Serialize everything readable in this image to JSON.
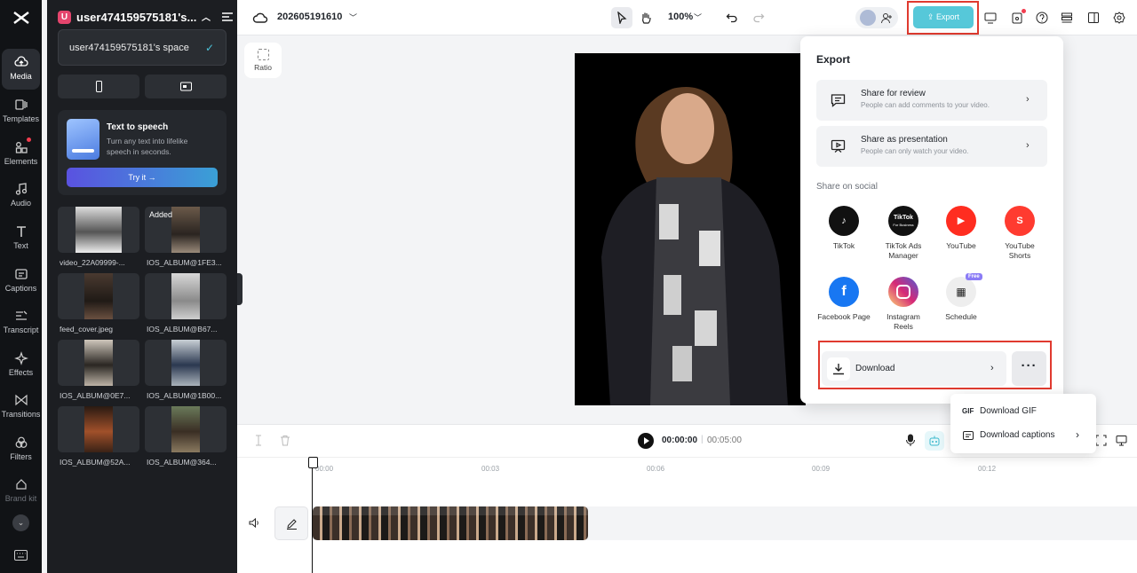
{
  "workspace": {
    "badge": "U",
    "name": "user474159575181's...",
    "dropdown_item": "user474159575181's space"
  },
  "rail": {
    "items": [
      "Media",
      "Templates",
      "Elements",
      "Audio",
      "Text",
      "Captions",
      "Transcript",
      "Effects",
      "Transitions",
      "Filters",
      "Brand kit"
    ]
  },
  "tts": {
    "title": "Text to speech",
    "desc": "Turn any text into lifelike speech in seconds.",
    "button": "Try it →"
  },
  "media": [
    {
      "name": "video_22A09999-...",
      "added": ""
    },
    {
      "name": "IOS_ALBUM@1FE3...",
      "added": "Added"
    },
    {
      "name": "feed_cover.jpeg",
      "added": ""
    },
    {
      "name": "IOS_ALBUM@B67...",
      "added": ""
    },
    {
      "name": "IOS_ALBUM@0E7...",
      "added": ""
    },
    {
      "name": "IOS_ALBUM@1B00...",
      "added": ""
    },
    {
      "name": "IOS_ALBUM@52A...",
      "added": ""
    },
    {
      "name": "IOS_ALBUM@364...",
      "added": ""
    }
  ],
  "topbar": {
    "project_name": "202605191610",
    "zoom": "100%",
    "export_label": "Export"
  },
  "canvas": {
    "ratio_label": "Ratio"
  },
  "timeline": {
    "current": "00:00:00",
    "separator": "|",
    "duration": "00:05:00",
    "ticks": [
      "00:00",
      "00:03",
      "00:06",
      "00:09",
      "00:12"
    ]
  },
  "export_panel": {
    "title": "Export",
    "review_title": "Share for review",
    "review_desc": "People can add comments to your video.",
    "presentation_title": "Share as presentation",
    "presentation_desc": "People can only watch your video.",
    "social_heading": "Share on social",
    "social": [
      {
        "label": "TikTok",
        "color": "#111111"
      },
      {
        "label": "TikTok Ads Manager",
        "color": "#111111"
      },
      {
        "label": "YouTube",
        "color": "#ff2d20"
      },
      {
        "label": "YouTube Shorts",
        "color": "#ff3b30"
      },
      {
        "label": "Facebook Page",
        "color": "#1877f2"
      },
      {
        "label": "Instagram Reels",
        "color": "#d62976"
      },
      {
        "label": "Schedule",
        "color": "#eeeeee",
        "badge": "Free"
      }
    ],
    "tiktok_ads_logo": "TikTok",
    "tiktok_ads_sub": "For Business",
    "download_label": "Download",
    "more_label": "···"
  },
  "download_menu": {
    "gif_icon": "GIF",
    "gif_label": "Download GIF",
    "captions_label": "Download captions"
  },
  "colors": {
    "accent": "#56c8d9",
    "highlight": "#e03a2f"
  }
}
